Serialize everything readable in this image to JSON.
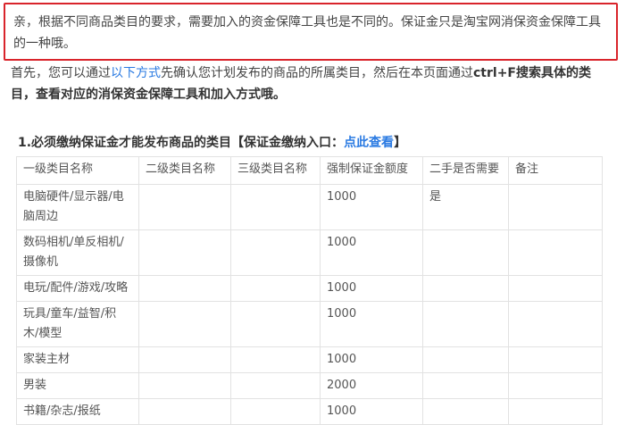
{
  "notice": {
    "line1": "亲，根据不同商品类目的要求，需要加入的资金保障工具也是不同的。保证金只是淘宝网消保资金保障工具",
    "line2": "的一种哦。"
  },
  "intro": {
    "part1": "首先，您可以通过",
    "link": "以下方式",
    "part2": "先确认您计划发布的商品的所属类目，然后在本页面通过",
    "bold1": "ctrl+F搜索具体的类",
    "bold2": "目，查看对应的消保资金保障工具和加入方式哦。"
  },
  "section": {
    "title": "1.必须缴纳保证金才能发布商品的类目【保证金缴纳入口：",
    "link": "点此查看",
    "close": "】"
  },
  "table": {
    "headers": [
      "一级类目名称",
      "二级类目名称",
      "三级类目名称",
      "强制保证金额度",
      "二手是否需要",
      "备注"
    ],
    "rows": [
      {
        "cat1_a": "电脑硬件/显示器/电",
        "cat1_b": "脑周边",
        "amount": "1000",
        "secondhand": "是"
      },
      {
        "cat1_a": "数码相机/单反相机/",
        "cat1_b": "摄像机",
        "amount": "1000",
        "secondhand": ""
      },
      {
        "cat1_a": "电玩/配件/游戏/攻略",
        "cat1_b": "",
        "amount": "1000",
        "secondhand": ""
      },
      {
        "cat1_a": "玩具/童车/益智/积",
        "cat1_b": "木/模型",
        "amount": "1000",
        "secondhand": ""
      },
      {
        "cat1_a": "家装主材",
        "cat1_b": "",
        "amount": "1000",
        "secondhand": ""
      },
      {
        "cat1_a": "男装",
        "cat1_b": "",
        "amount": "2000",
        "secondhand": ""
      },
      {
        "cat1_a": "书籍/杂志/报纸",
        "cat1_b": "",
        "amount": "1000",
        "secondhand": ""
      }
    ]
  }
}
